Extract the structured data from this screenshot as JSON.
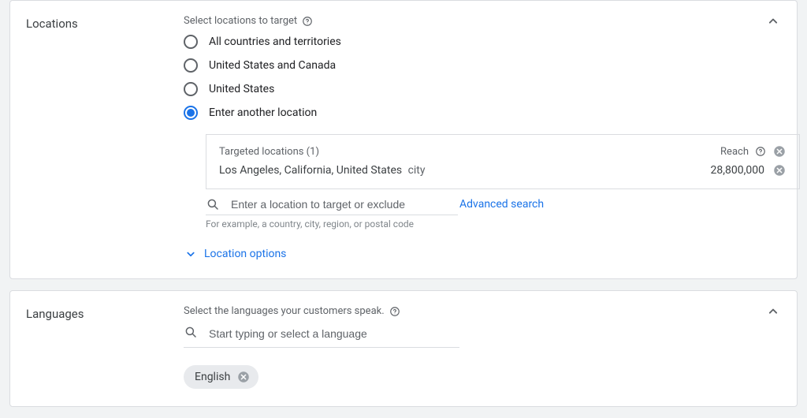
{
  "colors": {
    "link": "#1a73e8",
    "muted": "#5f6368"
  },
  "locations": {
    "title": "Locations",
    "hint": "Select locations to target",
    "radios": [
      {
        "label": "All countries and territories",
        "selected": false
      },
      {
        "label": "United States and Canada",
        "selected": false
      },
      {
        "label": "United States",
        "selected": false
      },
      {
        "label": "Enter another location",
        "selected": true
      }
    ],
    "targeted": {
      "header_label": "Targeted locations (1)",
      "reach_label": "Reach",
      "rows": [
        {
          "name": "Los Angeles, California, United States",
          "type": "city",
          "reach": "28,800,000"
        }
      ]
    },
    "search": {
      "placeholder": "Enter a location to target or exclude",
      "helper": "For example, a country, city, region, or postal code",
      "advanced_label": "Advanced search"
    },
    "options_label": "Location options"
  },
  "languages": {
    "title": "Languages",
    "hint": "Select the languages your customers speak.",
    "search_placeholder": "Start typing or select a language",
    "chips": [
      {
        "label": "English"
      }
    ]
  }
}
